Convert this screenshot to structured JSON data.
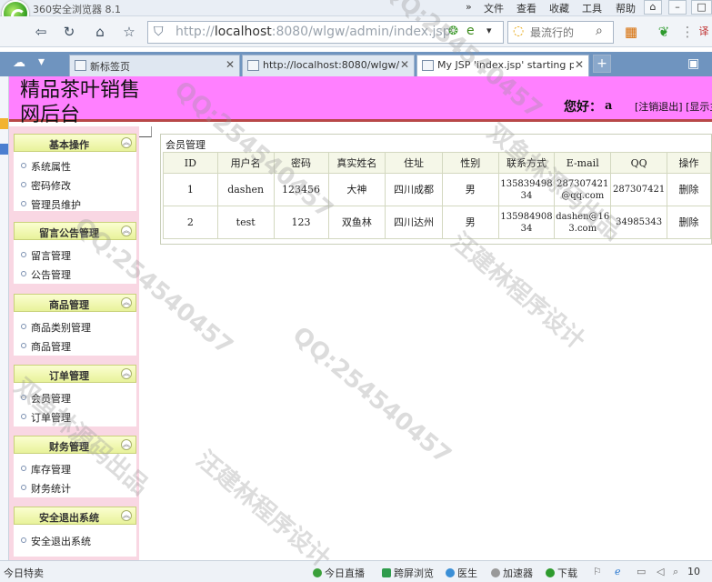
{
  "browser": {
    "title": "360安全浏览器 8.1",
    "menu": [
      "文件",
      "查看",
      "收藏",
      "工具",
      "帮助"
    ],
    "url_prefix": "http://",
    "url_host": "localhost",
    "url_rest": ":8080/wlgw/admin/index.jsp",
    "search_placeholder": "最流行的",
    "tabs": [
      {
        "label": "新标签页",
        "active": false
      },
      {
        "label": "http://localhost:8080/wlgw/i",
        "active": false
      },
      {
        "label": "My JSP 'index.jsp' starting p",
        "active": true
      }
    ]
  },
  "header": {
    "site_title": "精品茶叶销售网后台",
    "greeting": "您好：",
    "user": "a",
    "links": "[注销退出] [显示主页]"
  },
  "sidebar": {
    "groups": [
      {
        "title": "基本操作",
        "items": [
          "系统属性",
          "密码修改",
          "管理员维护"
        ]
      },
      {
        "title": "留言公告管理",
        "items": [
          "留言管理",
          "公告管理"
        ]
      },
      {
        "title": "商品管理",
        "items": [
          "商品类别管理",
          "商品管理"
        ]
      },
      {
        "title": "订单管理",
        "items": [
          "会员管理",
          "订单管理"
        ]
      },
      {
        "title": "财务管理",
        "items": [
          "库存管理",
          "财务统计"
        ]
      },
      {
        "title": "安全退出系统",
        "items": [
          "安全退出系统"
        ]
      }
    ]
  },
  "main": {
    "panel_title": "会员管理",
    "columns": [
      "ID",
      "用户名",
      "密码",
      "真实姓名",
      "住址",
      "性别",
      "联系方式",
      "E-mail",
      "QQ",
      "操作"
    ],
    "rows": [
      {
        "id": "1",
        "username": "dashen",
        "password": "123456",
        "realname": "大神",
        "address": "四川成都",
        "gender": "男",
        "phone": "13583949834",
        "email": "287307421@qq.com",
        "qq": "287307421",
        "action": "删除"
      },
      {
        "id": "2",
        "username": "test",
        "password": "123",
        "realname": "双鱼林",
        "address": "四川达州",
        "gender": "男",
        "phone": "13598490834",
        "email": "dashen@163.com",
        "qq": "34985343",
        "action": "删除"
      }
    ]
  },
  "statusbar": {
    "left": "今日特卖",
    "items": [
      "今日直播",
      "跨屏浏览",
      "医生",
      "加速器",
      "下载"
    ],
    "zoom": "10"
  },
  "watermark": [
    "QQ:254540457",
    "汪建林程序设计",
    "双鱼林源码出品"
  ]
}
